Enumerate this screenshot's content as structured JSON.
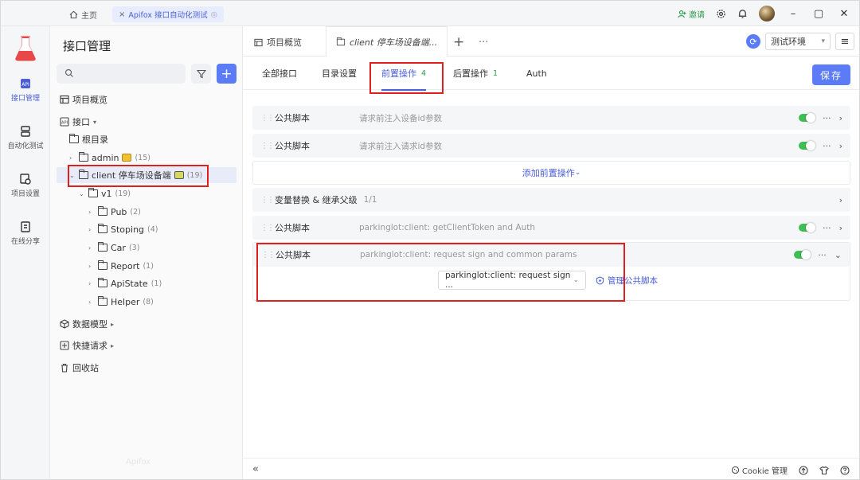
{
  "titlebar": {
    "home_label": "主页",
    "api_tab_label": "Apifox 接口自动化测试",
    "invite_label": "邀请"
  },
  "rail": {
    "items": [
      {
        "label": "接口管理",
        "icon": "api-management-icon",
        "active": true
      },
      {
        "label": "自动化测试",
        "icon": "automation-icon"
      },
      {
        "label": "项目设置",
        "icon": "project-settings-icon"
      },
      {
        "label": "在线分享",
        "icon": "share-icon"
      }
    ]
  },
  "sidebar": {
    "title": "接口管理",
    "project_overview": "项目概览",
    "api_label": "接口",
    "root": "根目录",
    "admin": {
      "label": "admin",
      "count": "(15)"
    },
    "client": {
      "label": "client 停车场设备端",
      "count": "(19)"
    },
    "v1": {
      "label": "v1",
      "count": "(19)"
    },
    "folders": [
      {
        "label": "Pub",
        "count": "(2)"
      },
      {
        "label": "Stoping",
        "count": "(4)"
      },
      {
        "label": "Car",
        "count": "(3)"
      },
      {
        "label": "Report",
        "count": "(1)"
      },
      {
        "label": "ApiState",
        "count": "(1)"
      },
      {
        "label": "Helper",
        "count": "(8)"
      }
    ],
    "data_model": "数据模型",
    "quick_request": "快捷请求",
    "recycle": "回收站",
    "watermark": "Apifox"
  },
  "main": {
    "tabs": {
      "overview": "项目概览",
      "client": "client 停车场设备端..."
    },
    "env": "测试环境",
    "subtabs": {
      "all": "全部接口",
      "dir": "目录设置",
      "pre": "前置操作",
      "pre_count": "4",
      "post": "后置操作",
      "post_count": "1",
      "auth": "Auth"
    },
    "save": "保存",
    "ops": [
      {
        "name": "公共脚本",
        "desc": "请求前注入设备id参数"
      },
      {
        "name": "公共脚本",
        "desc": "请求前注入请求id参数"
      }
    ],
    "add_pre": "添加前置操作",
    "var_replace": {
      "name": "变量替换 & 继承父级",
      "count": "1/1"
    },
    "ops2": [
      {
        "name": "公共脚本",
        "desc": "parkinglot:client: getClientToken and Auth"
      },
      {
        "name": "公共脚本",
        "desc": "parkinglot:client: request sign and common params"
      }
    ],
    "script_select": "parkinglot:client: request sign ...",
    "manage_script": "管理公共脚本",
    "footer": {
      "cookie": "Cookie 管理"
    }
  },
  "colors": {
    "accent": "#5b7cf6",
    "annotation": "#e02020",
    "toggle_on": "#3fbf52"
  }
}
